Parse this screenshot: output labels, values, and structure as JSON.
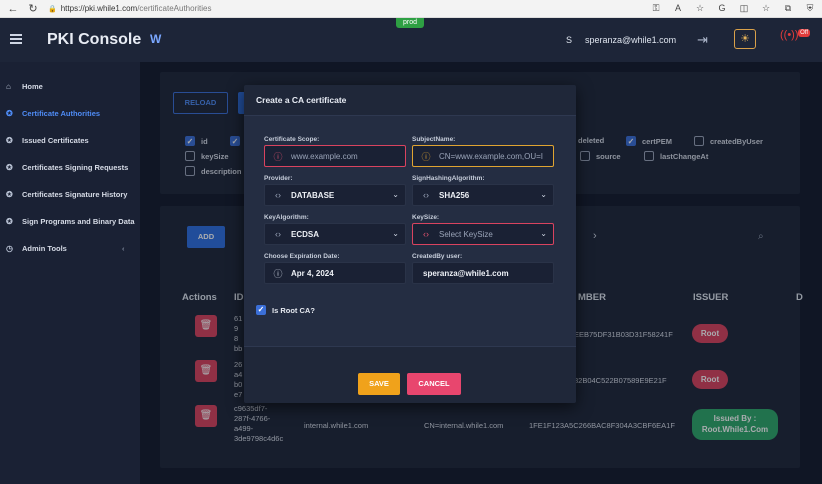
{
  "browser": {
    "url_host": "https://pki.while1.com",
    "url_path": "/certificateAuthorities",
    "icons": [
      "back-icon",
      "refresh-icon",
      "lock-icon",
      "key-icon",
      "read-aloud-icon",
      "star-icon",
      "extension-icon",
      "split-icon",
      "favorites-icon",
      "collections-icon",
      "shield-icon"
    ]
  },
  "header": {
    "env_badge": "prod",
    "title": "PKI Console",
    "logo_text": "W",
    "user_initial": "S",
    "user_email": "speranza@while1.com",
    "signal_badge": "Off"
  },
  "sidebar": {
    "items": [
      {
        "label": "Home",
        "icon": "home-icon"
      },
      {
        "label": "Certificate Authorities",
        "icon": "badge-icon"
      },
      {
        "label": "Issued Certificates",
        "icon": "badge-icon"
      },
      {
        "label": "Certificates Signing Requests",
        "icon": "badge-icon"
      },
      {
        "label": "Certificates Signature History",
        "icon": "badge-icon"
      },
      {
        "label": "Sign Programs and Binary Data",
        "icon": "badge-icon"
      },
      {
        "label": "Admin Tools",
        "icon": "clock-icon"
      }
    ]
  },
  "toolbar": {
    "reload_label": "RELOAD",
    "add_label": "ADD"
  },
  "columns_filter": [
    {
      "label": "id",
      "checked": true
    },
    {
      "label": "deleted",
      "checked": false
    },
    {
      "label": "certPEM",
      "checked": true
    },
    {
      "label": "createdByUser",
      "checked": false
    },
    {
      "label": "keySize",
      "checked": false
    },
    {
      "label": "source",
      "checked": false
    },
    {
      "label": "lastChangeAt",
      "checked": false
    },
    {
      "label": "description",
      "checked": false
    }
  ],
  "table": {
    "headers": {
      "actions": "Actions",
      "id": "ID",
      "serial": "MBER",
      "issuer": "ISSUER",
      "extra": "D"
    },
    "rows": [
      {
        "id": "61\n9\n8\nbb",
        "serial": "EEB75DF31B03D31F58241F",
        "issuer": "Root"
      },
      {
        "id": "26\na4\nb0\ne7",
        "serial": "82B04C522B07589E9E21F",
        "issuer": "Root"
      },
      {
        "id": "c9635df7-\n287f-4766-\na499-\n3de9798c4d6c",
        "name": "internal.while1.com",
        "subject": "CN=internal.while1.com",
        "serial": "1FE1F123A5C266BAC8F304A3CBF6EA1F",
        "issuer": "Issued By :\nRoot.While1.Com"
      }
    ]
  },
  "modal": {
    "title": "Create a CA certificate",
    "fields": {
      "scope_label": "Certificate Scope:",
      "scope_placeholder": "www.example.com",
      "subject_label": "SubjectName:",
      "subject_placeholder": "CN=www.example.com,OU=I",
      "provider_label": "Provider:",
      "provider_value": "DATABASE",
      "hashing_label": "SignHashingAlgorithm:",
      "hashing_value": "SHA256",
      "keyalg_label": "KeyAlgorithm:",
      "keyalg_value": "ECDSA",
      "keysize_label": "KeySize:",
      "keysize_placeholder": "Select KeySize",
      "expiration_label": "Choose Expiration Date:",
      "expiration_value": "Apr 4, 2024",
      "createdby_label": "CreatedBy user:",
      "createdby_value": "speranza@while1.com"
    },
    "root_ca_label": "Is Root CA?",
    "root_ca_checked": true,
    "save_label": "SAVE",
    "cancel_label": "CANCEL"
  },
  "colors": {
    "accent": "#3b6fd8",
    "danger": "#d9435f",
    "warning": "#f0a21b",
    "success": "#2ea86b"
  }
}
